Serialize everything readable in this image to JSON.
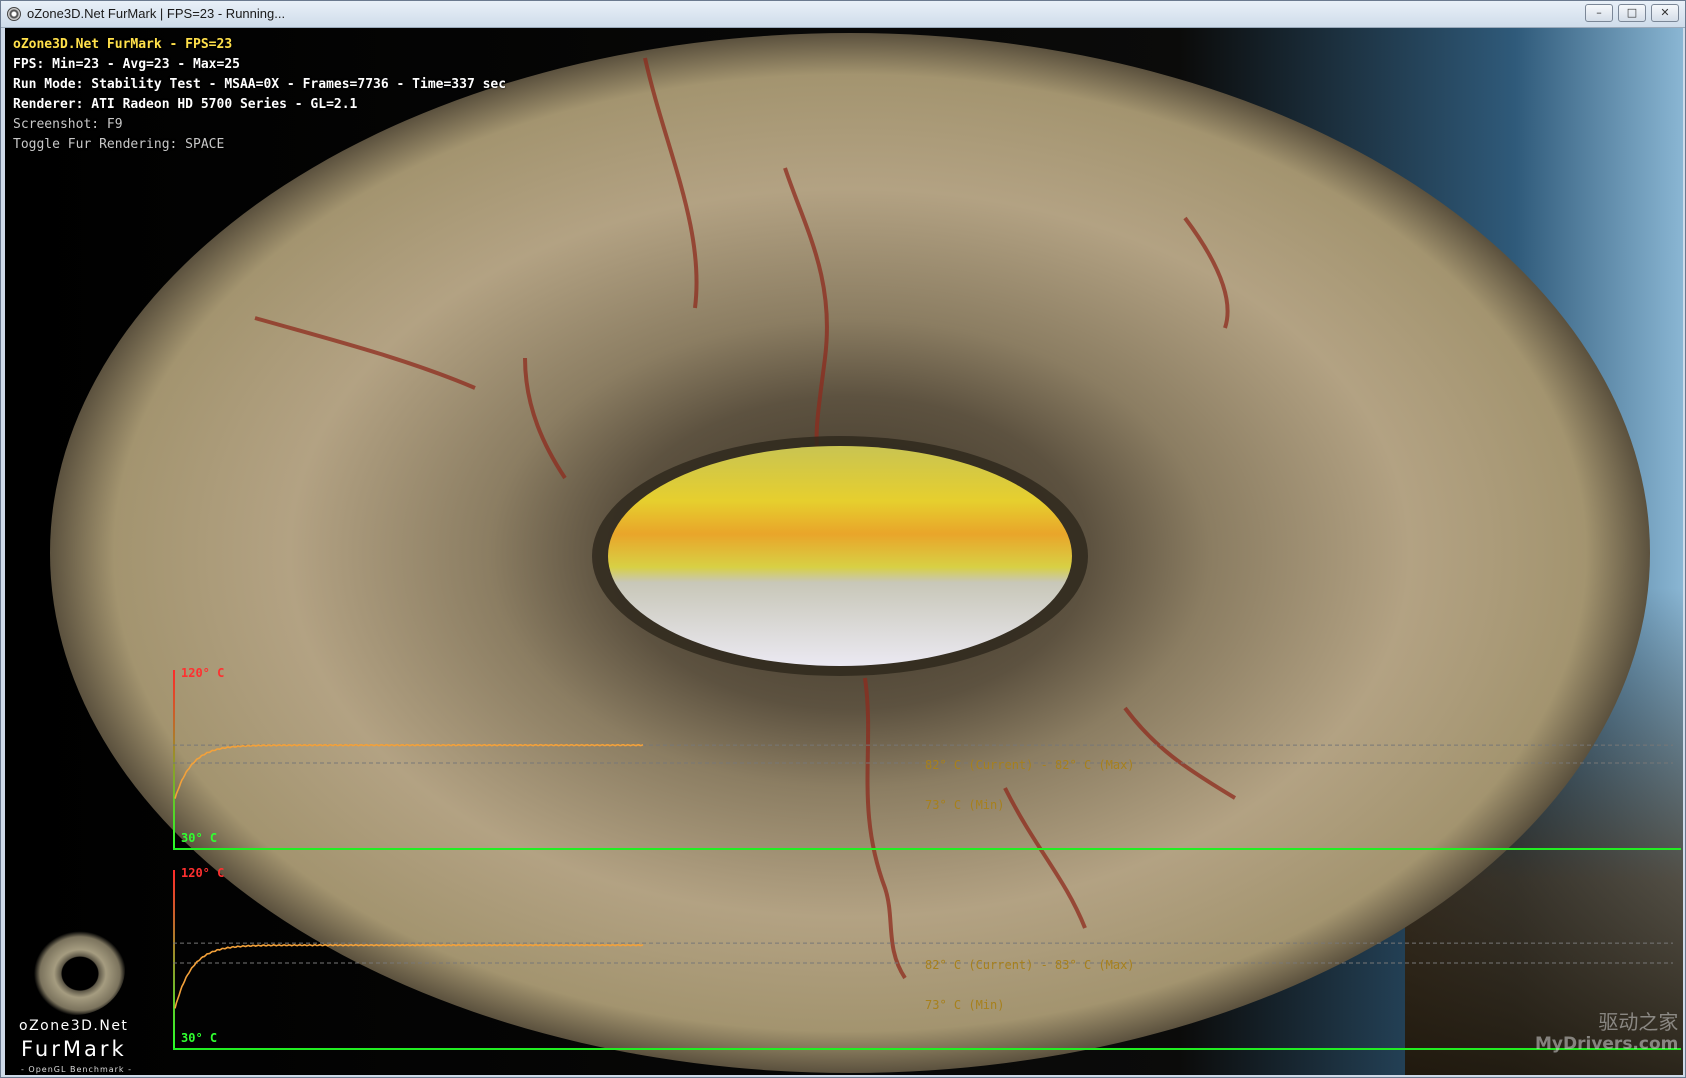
{
  "window": {
    "title": "oZone3D.Net FurMark | FPS=23 - Running...",
    "minimize_glyph": "–",
    "maximize_glyph": "□",
    "close_glyph": "✕"
  },
  "hud": {
    "title": "oZone3D.Net FurMark - FPS=23",
    "fps": "FPS: Min=23 - Avg=23 - Max=25",
    "run_mode": "Run Mode: Stability Test - MSAA=0X - Frames=7736 - Time=337 sec",
    "renderer": "Renderer: ATI Radeon HD 5700 Series - GL=2.1",
    "screenshot": "Screenshot: F9",
    "toggle": "Toggle Fur Rendering: SPACE"
  },
  "graphs": [
    {
      "label_max": "120° C",
      "label_min": "30° C",
      "readout_current": "82° C (Current) - 82° C (Max)",
      "readout_min": "73° C (Min)"
    },
    {
      "label_max": "120° C",
      "label_min": "30° C",
      "readout_current": "82° C (Current) - 83° C (Max)",
      "readout_min": "73° C (Min)"
    }
  ],
  "chart_data": [
    {
      "type": "line",
      "ylim": [
        30,
        120
      ],
      "current": 82,
      "max": 82,
      "min": 73,
      "start": 55,
      "samples": 337
    },
    {
      "type": "line",
      "ylim": [
        30,
        120
      ],
      "current": 82,
      "max": 83,
      "min": 73,
      "start": 50,
      "samples": 337
    }
  ],
  "logo": {
    "line1": "oZone3D.Net",
    "line2": "FurMark",
    "line3": "- OpenGL Benchmark -"
  },
  "watermark": {
    "line1": "驱动之家",
    "line2": "MyDrivers.com"
  },
  "colors": {
    "hud_title": "#ffe04a",
    "curve": "#f3a13a",
    "axis_max": "#ff3030",
    "axis_min": "#30ff30",
    "readout": "#a7801c"
  },
  "icons": {
    "app": "furmark-app-icon"
  }
}
